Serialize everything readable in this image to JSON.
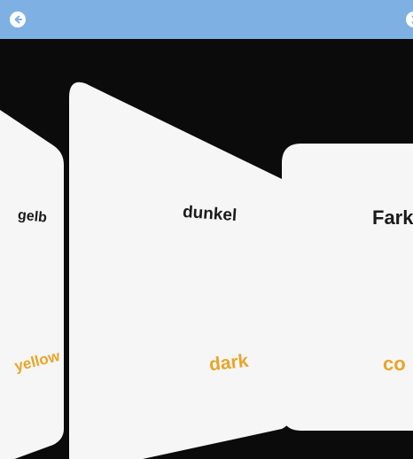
{
  "toolbar": {
    "back_icon": "arrow-left-circle-icon",
    "forward_icon": "arrow-right-circle-icon",
    "bar_color": "#7fb0e3"
  },
  "colors": {
    "stage_bg": "#0b0b0b",
    "card_bg": "#f6f6f6",
    "word_de": "#1a1a1a",
    "word_en": "#e9a52a"
  },
  "cards": [
    {
      "word": "gelb",
      "translation": "yellow"
    },
    {
      "word": "dunkel",
      "translation": "dark"
    },
    {
      "word": "Fark",
      "translation": "co"
    }
  ]
}
